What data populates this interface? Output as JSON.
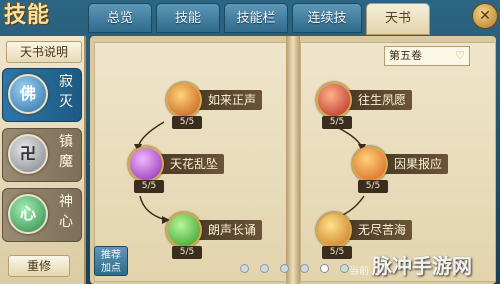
{
  "header": {
    "logo_text": "技能",
    "tabs": [
      {
        "label": "总览"
      },
      {
        "label": "技能"
      },
      {
        "label": "技能栏"
      },
      {
        "label": "连续技"
      },
      {
        "label": "天书"
      }
    ],
    "active_tab": "天书",
    "close_icon": "close-icon"
  },
  "sidebar": {
    "title": "天书说明",
    "items": [
      {
        "name": "寂灭",
        "glyph": "佛",
        "color": "#3f7fb5"
      },
      {
        "name": "镇魔",
        "glyph": "卍",
        "color": "#6c7480"
      },
      {
        "name": "神心",
        "glyph": "心",
        "color": "#2f8a4a"
      }
    ],
    "reset_label": "重修"
  },
  "book": {
    "volume": "第五卷",
    "left_skills": [
      {
        "name": "如来正声",
        "level": "5/5",
        "color": "#e0762a"
      },
      {
        "name": "天花乱坠",
        "level": "5/5",
        "color": "#a33fc4"
      },
      {
        "name": "朗声长诵",
        "level": "5/5",
        "color": "#3aa53a"
      }
    ],
    "right_skills": [
      {
        "name": "往生夙愿",
        "level": "5/5",
        "color": "#c9332a"
      },
      {
        "name": "因果报应",
        "level": "5/5",
        "color": "#e5772a"
      },
      {
        "name": "无尽苦海",
        "level": "5/5",
        "color": "#d9882c"
      }
    ]
  },
  "footer": {
    "side_tab_label": "推荐加点",
    "page_dots": 6,
    "active_dot": 4,
    "text": "当前",
    "watermark": "脉冲手游网"
  }
}
